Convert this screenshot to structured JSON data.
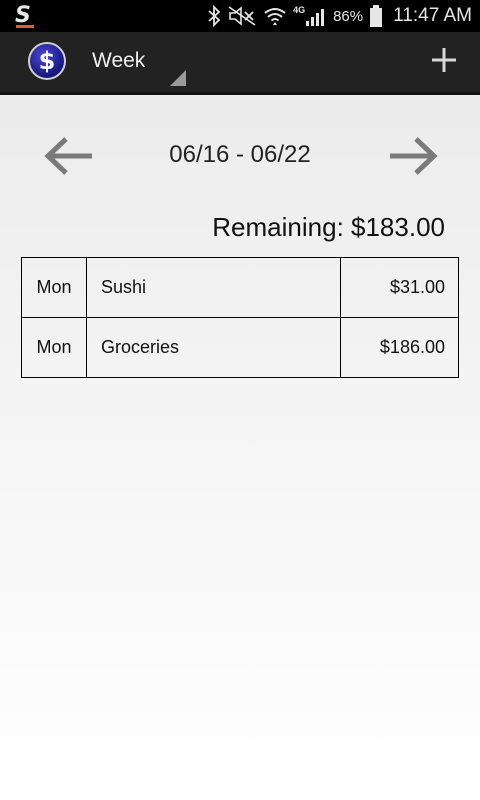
{
  "status_bar": {
    "battery_percent": "86%",
    "time": "11:47 AM",
    "network": "4G",
    "icons": [
      "s-app-icon",
      "bluetooth-icon",
      "mute-icon",
      "wifi-icon",
      "signal-icon",
      "battery-icon"
    ]
  },
  "action_bar": {
    "logo_symbol": "$",
    "period_selector": "Week",
    "add_icon": "plus-icon"
  },
  "navigation": {
    "week_range": "06/16 - 06/22",
    "prev_icon": "arrow-left-icon",
    "next_icon": "arrow-right-icon"
  },
  "summary": {
    "remaining_label": "Remaining: $183.00"
  },
  "expenses": [
    {
      "day": "Mon",
      "description": "Sushi",
      "amount": "$31.00"
    },
    {
      "day": "Mon",
      "description": "Groceries",
      "amount": "$186.00"
    }
  ]
}
